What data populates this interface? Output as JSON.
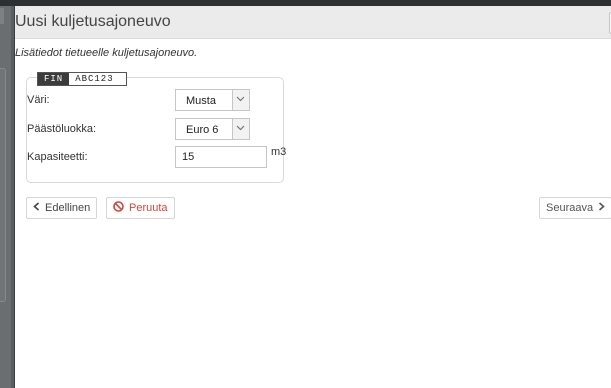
{
  "dialog": {
    "title": "Uusi kuljetusajoneuvo",
    "intro": "Lisätiedot tietueelle kuljetusajoneuvo."
  },
  "vehicle": {
    "country": "FIN",
    "plate": "ABC123"
  },
  "form": {
    "color": {
      "label": "Väri:",
      "value": "Musta"
    },
    "emission": {
      "label": "Päästöluokka:",
      "value": "Euro 6"
    },
    "capacity": {
      "label": "Kapasiteetti:",
      "value": "15",
      "unit": "m3"
    }
  },
  "actions": {
    "previous": "Edellinen",
    "cancel": "Peruuta",
    "next": "Seuraava"
  },
  "colors": {
    "cancel": "#d9443a",
    "header_bg": "#ebebeb",
    "overlay": "#5a5e61"
  }
}
